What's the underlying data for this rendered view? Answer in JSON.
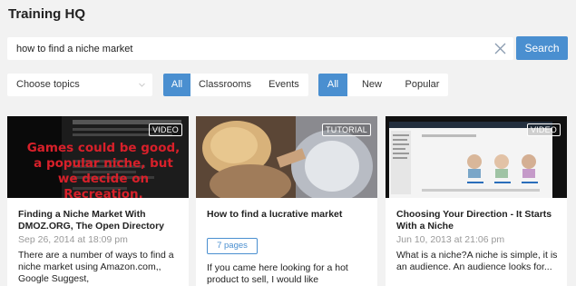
{
  "header": {
    "title": "Training HQ"
  },
  "search": {
    "value": "how to find a niche market",
    "button_label": "Search",
    "clear_icon": "close-icon"
  },
  "filters": {
    "topics_placeholder": "Choose topics",
    "type_options": [
      "All",
      "Classrooms",
      "Events"
    ],
    "type_selected": "All",
    "sort_options": [
      "All",
      "New",
      "Popular"
    ],
    "sort_selected": "All"
  },
  "colors": {
    "accent": "#4a8fd0",
    "background": "#f2f2f2",
    "date_gray": "#999999"
  },
  "cards": [
    {
      "badge": "VIDEO",
      "thumb_text": "Games could be good, a popular niche, but we decide on Recreation.",
      "title": "Finding a Niche Market With DMOZ.ORG, The Open Directory",
      "date": "Sep 26, 2014 at 18:09 pm",
      "desc": "There are a number of ways to find a niche market using Amazon.com,, Google Suggest,"
    },
    {
      "badge": "TUTORIAL",
      "title": "How to find a lucrative market",
      "pages": "7 pages",
      "desc": "If you came here looking for a hot product to sell, I would like"
    },
    {
      "badge": "VIDEO",
      "title": "Choosing Your Direction - It Starts With a Niche",
      "date": "Jun 10, 2013 at 21:06 pm",
      "desc": "What is a niche?A niche is simple, it is an audience. An audience looks for..."
    }
  ]
}
